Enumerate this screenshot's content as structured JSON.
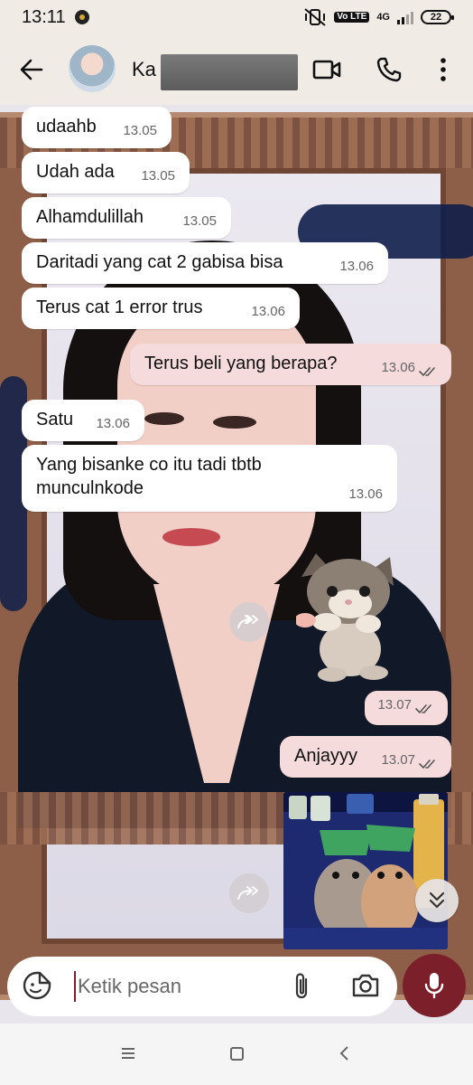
{
  "status_bar": {
    "time": "13:11",
    "network": "4G",
    "lte": "Vo LTE",
    "battery": "22"
  },
  "header": {
    "contact_name": "Ka"
  },
  "messages": [
    {
      "text": "udaahb",
      "time": "13.05",
      "direction": "in"
    },
    {
      "text": "Udah ada",
      "time": "13.05",
      "direction": "in"
    },
    {
      "text": "Alhamdulillah",
      "time": "13.05",
      "direction": "in"
    },
    {
      "text": "Daritadi yang cat 2 gabisa bisa",
      "time": "13.06",
      "direction": "in"
    },
    {
      "text": "Terus cat 1 error trus",
      "time": "13.06",
      "direction": "in"
    },
    {
      "text": "Terus beli yang berapa?",
      "time": "13.06",
      "direction": "out"
    },
    {
      "text": "Satu",
      "time": "13.06",
      "direction": "in"
    },
    {
      "text": "Yang bisanke co itu tadi tbtb munculnkode",
      "time": "13.06",
      "direction": "in"
    },
    {
      "text": "",
      "time": "13.07",
      "direction": "out",
      "type": "sticker"
    },
    {
      "text": "Anjayyy",
      "time": "13.07",
      "direction": "out"
    }
  ],
  "input": {
    "placeholder": "Ketik pesan"
  },
  "colors": {
    "outgoing_bubble": "#f6dbdd",
    "incoming_bubble": "#ffffff",
    "accent": "#7b1f2b"
  }
}
